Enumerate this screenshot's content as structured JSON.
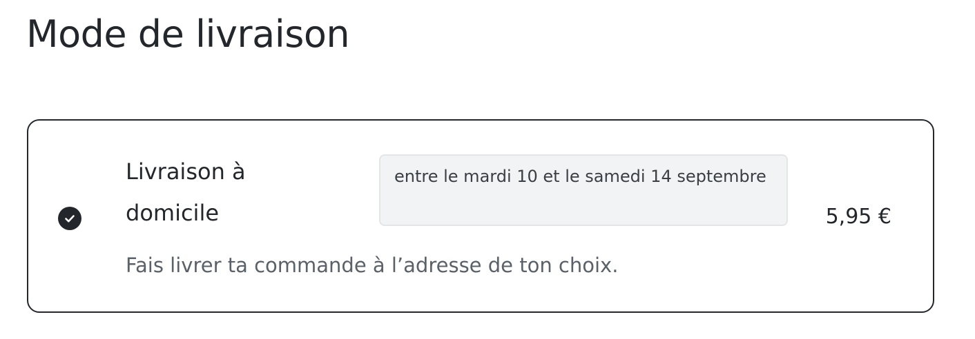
{
  "page": {
    "title": "Mode de livraison"
  },
  "delivery_option": {
    "name": "Livraison à domicile",
    "date_range": "entre le mardi 10 et le samedi 14 septembre",
    "price": "5,95 €",
    "description": "Fais livrer ta commande à l’adresse de ton choix.",
    "selected": true,
    "icon": "check-circle-icon"
  },
  "colors": {
    "text_primary": "#23272b",
    "text_secondary": "#5a6168",
    "date_background": "#f2f3f4",
    "border": "#23272b"
  }
}
